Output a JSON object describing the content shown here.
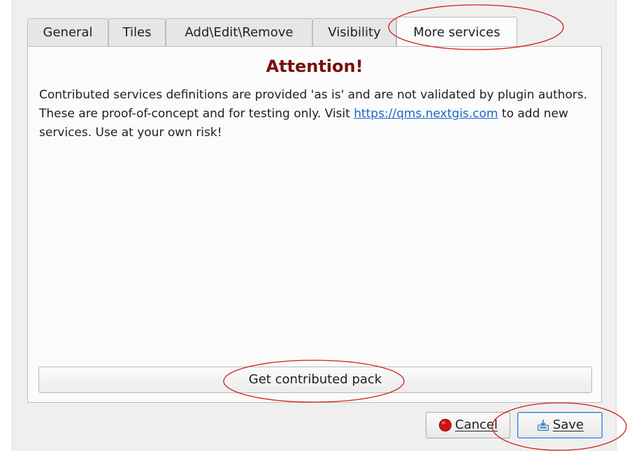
{
  "tabs": [
    {
      "label": "General",
      "active": false
    },
    {
      "label": "Tiles",
      "active": false
    },
    {
      "label": "Add\\Edit\\Remove",
      "active": false
    },
    {
      "label": "Visibility",
      "active": false
    },
    {
      "label": "More services",
      "active": true
    }
  ],
  "panel": {
    "heading": "Attention!",
    "message_before_link": "Contributed services definitions are provided 'as is' and are not validated by plugin authors. These are proof-of-concept and for testing only. Visit ",
    "link_text": "https://qms.nextgis.com",
    "message_after_link": " to add new services. Use at your own risk!",
    "get_pack_label": "Get contributed pack"
  },
  "buttons": {
    "cancel_label": "Cancel",
    "save_label": "Save"
  },
  "icons": {
    "cancel": "red-stop-icon",
    "save": "save-icon"
  },
  "colors": {
    "heading": "#7a0e0e",
    "link": "#1a66c7",
    "annotation": "#d01d1d"
  }
}
